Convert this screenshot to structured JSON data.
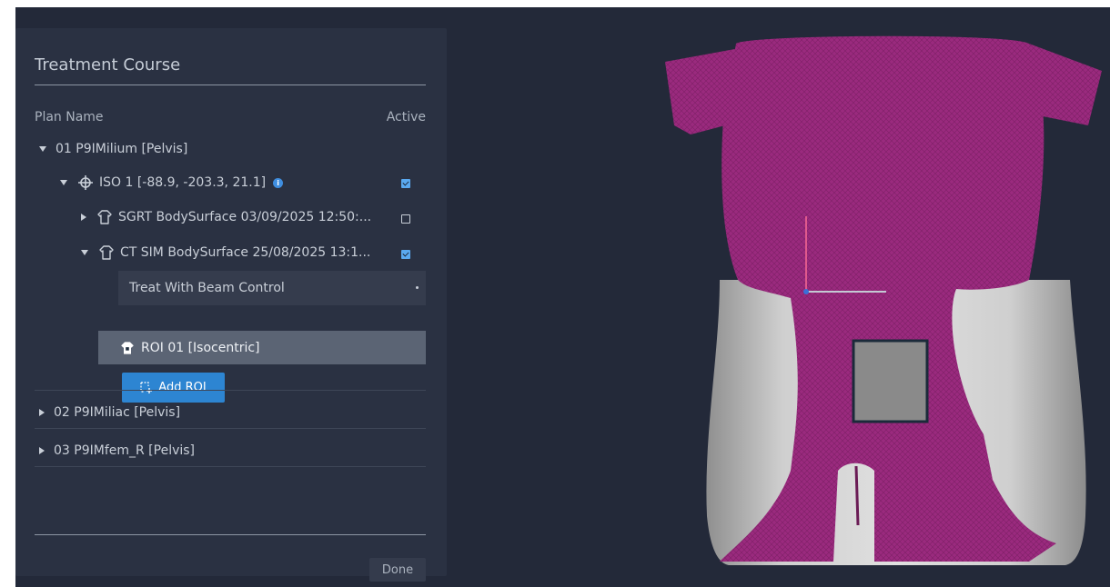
{
  "panel": {
    "title": "Treatment Course",
    "columns": {
      "plan_name": "Plan Name",
      "active": "Active"
    },
    "plans": [
      {
        "label": "01 P9IMilium [Pelvis]",
        "expanded": true
      },
      {
        "label": "02 P9IMiliac [Pelvis]",
        "expanded": false
      },
      {
        "label": "03 P9IMfem_R [Pelvis]",
        "expanded": false
      }
    ],
    "iso": {
      "label": "ISO 1 [-88.9, -203.3, 21.1]",
      "active": true,
      "icon": "crosshair-icon",
      "info_icon": "info-icon"
    },
    "surfaces": [
      {
        "label": "SGRT BodySurface 03/09/2025 12:50:...",
        "active": false,
        "expanded": false,
        "icon": "body-outline-icon"
      },
      {
        "label": "CT SIM BodySurface 25/08/2025 13:1...",
        "active": true,
        "expanded": true,
        "icon": "body-outline-icon"
      }
    ],
    "mode_select": {
      "value": "Treat With Beam Control"
    },
    "roi": {
      "label": "ROI 01 [Isocentric]",
      "icon": "body-filled-icon"
    },
    "add_roi_label": "Add ROI",
    "done_label": "Done"
  },
  "colors": {
    "app_bg": "#232939",
    "panel_bg": "#2a3142",
    "accent": "#2d85d2",
    "checkbox": "#5aa9f0",
    "surface_magenta": "#9a2a7e",
    "body_gray": "#bcbcbc",
    "roi_fill": "#8a8a8a",
    "roi_border": "#1b2a3a"
  }
}
